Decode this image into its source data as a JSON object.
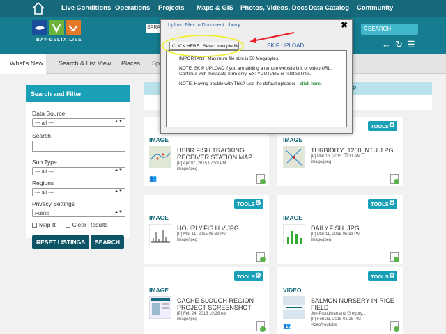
{
  "topnav": {
    "items": [
      "Live Conditions",
      "Operations",
      "Projects",
      "Maps & GIS",
      "Photos, Videos, Docs",
      "Data Catalog",
      "Community"
    ]
  },
  "header": {
    "logo_text": "BAY-DELTA LIVE",
    "search_label": "SEARCH",
    "search_fragment": "SARA"
  },
  "tabs": [
    "What's New",
    "Search & List View",
    "Places",
    "Sp"
  ],
  "sidebar": {
    "title": "Search and Filter",
    "data_source_label": "Data Source",
    "data_source_value": "--- all ---",
    "search_label": "Search",
    "subtype_label": "Sub Type",
    "subtype_value": "--- all ---",
    "regions_label": "Regions",
    "regions_value": "--- all ---",
    "privacy_label": "Privacy Settings",
    "privacy_value": "Public",
    "map_it_label": "Map It",
    "clear_results_label": "Clear Results",
    "reset_label": "RESET LISTINGS",
    "search_button": "SEARCH"
  },
  "map_tab_label": "ON MAP",
  "tools_label": "TOOLS",
  "cards": [
    {
      "type": "IMAGE",
      "title": "USBR FISH TRACKING RECEIVER STATION MAP",
      "meta1": "[P] Apr 07, 2015 07:59 PM",
      "meta2": "image/jpeg",
      "tools": false
    },
    {
      "type": "IMAGE",
      "title": "TURBIDITY_1200_NTU.J PG",
      "meta1": "[P] Mar 13, 2015 10:31 AM",
      "meta2": "image/jpeg",
      "tools": true
    },
    {
      "type": "IMAGE",
      "title": "HOURLY.FIS H.V.JPG",
      "meta1": "[P] Mar 11, 2015 05:39 PM",
      "meta2": "image/jpeg",
      "tools": true
    },
    {
      "type": "IMAGE",
      "title": "DAILY.FISH .JPG",
      "meta1": "[P] Mar 11, 2015 05:39 PM",
      "meta2": "image/jpeg",
      "tools": true
    },
    {
      "type": "IMAGE",
      "title": "CACHE SLOUGH REGION PROJECT SCREENSHOT",
      "meta1": "[P] Feb 24, 2015 10:28 AM",
      "meta2": "image/jpeg",
      "tools": true
    },
    {
      "type": "VIDEO",
      "title": "SALMON NURSERY IN RICE FIELD",
      "meta1": "Joe Proudman and Gregory...",
      "meta1b": "[P] Feb 23, 2015 01:28 PM",
      "meta2": "video/youtube",
      "tools": true
    }
  ],
  "dialog": {
    "title": "Upload Files to Document Library",
    "close": "✖",
    "click_button": "CLICK HERE : Select multiple files.",
    "skip_label": "SKIP UPLOAD",
    "important": "IMPORTANT! Maximum file size is 50 Megabytes.",
    "note1": "NOTE: SKIP UPLOAD if you are adding a remote website link or video URL. Continue with metadata form only. EX: YOUTUBE or related links.",
    "note2_prefix": "NOTE: Having trouble with This? Use the default uploader - ",
    "note2_link": "click here."
  },
  "colors": {
    "nav": "#15697a",
    "header": "#157d8f",
    "accent": "#1aa0b6",
    "dark_button": "#0d5566"
  }
}
